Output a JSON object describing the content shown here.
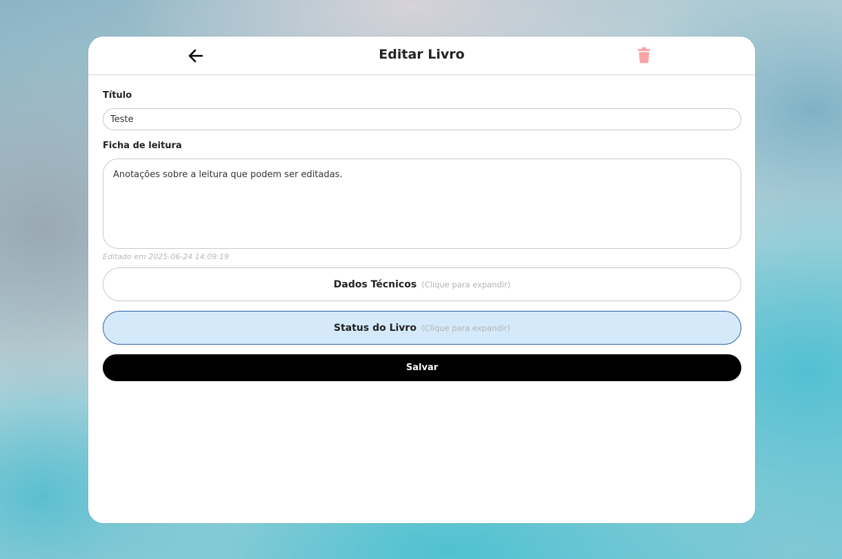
{
  "header": {
    "title": "Editar Livro",
    "back_icon": "arrow-left-icon",
    "delete_icon": "trash-icon",
    "delete_color": "#f8a5a5"
  },
  "form": {
    "title_label": "Título",
    "title_value": "Teste",
    "notes_label": "Ficha de leitura",
    "notes_value": "Anotações sobre a leitura que podem ser editadas.",
    "edited_note": "Editado em 2025-06-24 14:09:19"
  },
  "sections": {
    "technical": {
      "title": "Dados Técnicos",
      "hint": "(Clique para expandir)"
    },
    "status": {
      "title": "Status do Livro",
      "hint": "(Clique para expandir)",
      "accent_bg": "#d4eafa",
      "accent_border": "#2e5fa8"
    }
  },
  "actions": {
    "save_label": "Salvar"
  }
}
